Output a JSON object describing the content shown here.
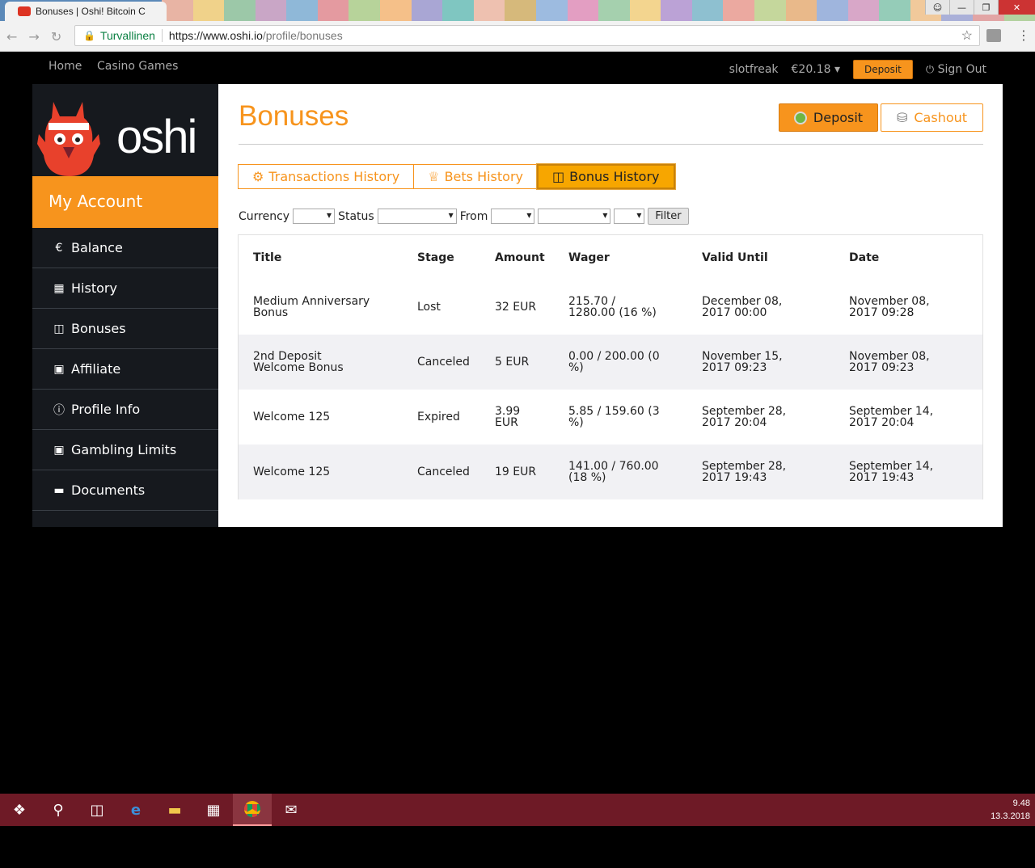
{
  "browser": {
    "tab_title": "Bonuses | Oshi! Bitcoin C",
    "secure_label": "Turvallinen",
    "url_host": "https://www.oshi.io",
    "url_path": "/profile/bonuses"
  },
  "topnav": {
    "home": "Home",
    "casino_games": "Casino Games",
    "username": "slotfreak",
    "balance": "€20.18",
    "deposit": "Deposit",
    "sign_out": "Sign Out"
  },
  "logo": {
    "text": "oshi"
  },
  "sidebar": {
    "header": "My Account",
    "items": [
      {
        "label": "Balance",
        "icon": "euro-icon"
      },
      {
        "label": "History",
        "icon": "calendar-icon"
      },
      {
        "label": "Bonuses",
        "icon": "gift-icon"
      },
      {
        "label": "Affiliate",
        "icon": "briefcase-icon"
      },
      {
        "label": "Profile Info",
        "icon": "info-icon"
      },
      {
        "label": "Gambling Limits",
        "icon": "lock-icon"
      },
      {
        "label": "Documents",
        "icon": "folder-icon"
      }
    ]
  },
  "main": {
    "title": "Bonuses",
    "deposit_btn": "Deposit",
    "cashout_btn": "Cashout",
    "tabs": [
      "Transactions History",
      "Bets History",
      "Bonus History"
    ],
    "filters": {
      "currency": "Currency",
      "status": "Status",
      "from": "From",
      "filter_btn": "Filter"
    }
  },
  "table": {
    "headers": [
      "Title",
      "Stage",
      "Amount",
      "Wager",
      "Valid Until",
      "Date"
    ],
    "rows": [
      {
        "title": "Medium Anniversary Bonus",
        "stage": "Lost",
        "amount": "32 EUR",
        "wager": "215.70 / 1280.00 (16 %)",
        "valid_until": "December 08, 2017 00:00",
        "date": "November 08, 2017 09:28"
      },
      {
        "title": "2nd Deposit Welcome Bonus",
        "stage": "Canceled",
        "amount": "5 EUR",
        "wager": "0.00 / 200.00 (0 %)",
        "valid_until": "November 15, 2017 09:23",
        "date": "November 08, 2017 09:23"
      },
      {
        "title": "Welcome 125",
        "stage": "Expired",
        "amount": "3.99 EUR",
        "wager": "5.85 / 159.60 (3 %)",
        "valid_until": "September 28, 2017 20:04",
        "date": "September 14, 2017 20:04"
      },
      {
        "title": "Welcome 125",
        "stage": "Canceled",
        "amount": "19 EUR",
        "wager": "141.00 / 760.00 (18 %)",
        "valid_until": "September 28, 2017 19:43",
        "date": "September 14, 2017 19:43"
      }
    ]
  },
  "taskbar": {
    "time": "9.48",
    "date": "13.3.2018"
  },
  "colors": {
    "accent": "#f7941d",
    "sidebar_bg": "#16191e",
    "taskbar": "#6e1a26"
  }
}
